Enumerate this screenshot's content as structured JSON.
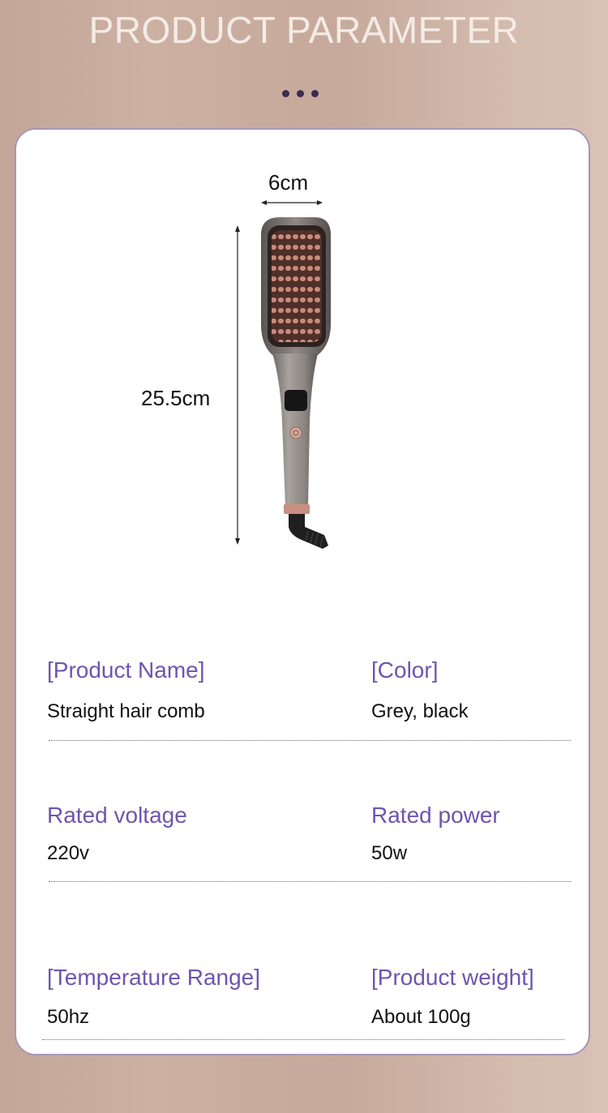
{
  "header": {
    "title": "PRODUCT PARAMETER"
  },
  "dimensions": {
    "width_label": "6cm",
    "height_label": "25.5cm"
  },
  "specs": {
    "product_name": {
      "label": "[Product Name]",
      "value": "Straight hair comb"
    },
    "color": {
      "label": "[Color]",
      "value": "Grey, black"
    },
    "rated_voltage": {
      "label": "Rated voltage",
      "value": "220v"
    },
    "rated_power": {
      "label": "Rated power",
      "value": "50w"
    },
    "temperature_range": {
      "label": "[Temperature Range]",
      "value": "50hz"
    },
    "product_weight": {
      "label": "[Product weight]",
      "value": "About 100g"
    }
  },
  "colors": {
    "accent": "#6e55ad",
    "card_border": "#a896b8",
    "dots": "#3e2b52"
  }
}
